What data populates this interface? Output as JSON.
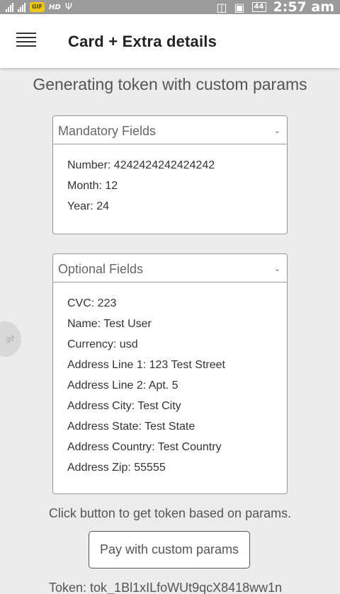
{
  "status_bar": {
    "gif_badge": "GIF",
    "hd": "HD",
    "battery": "44",
    "time": "2:57 am"
  },
  "app_bar": {
    "title": "Card + Extra details"
  },
  "subtitle": "Generating token with custom params",
  "mandatory": {
    "title": "Mandatory Fields",
    "fields": [
      "Number: 4242424242424242",
      "Month: 12",
      "Year: 24"
    ]
  },
  "optional": {
    "title": "Optional Fields",
    "fields": [
      "CVC: 223",
      "Name: Test User",
      "Currency: usd",
      "Address Line 1: 123 Test Street",
      "Address Line 2: Apt. 5",
      "Address City: Test City",
      "Address State: Test State",
      "Address Country: Test Country",
      "Address Zip: 55555"
    ]
  },
  "side_bubble": "gif",
  "hint": "Click button to get token based on params.",
  "pay_button": "Pay with custom params",
  "token": "Token: tok_1Bl1xILfoWUt9qcX8418ww1n"
}
